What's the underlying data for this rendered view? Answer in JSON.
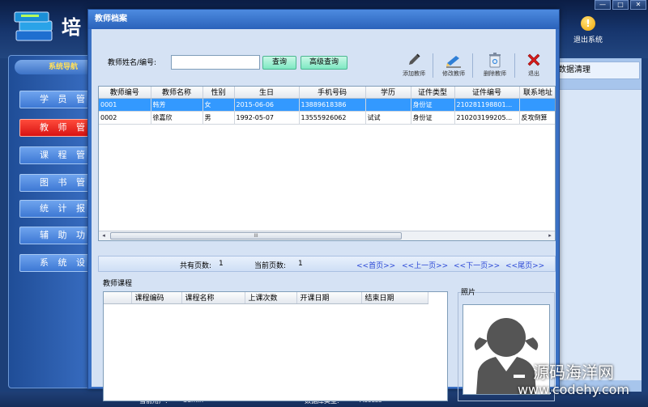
{
  "app": {
    "title": "培",
    "exit_label": "退出系统",
    "window_controls": [
      "—",
      "□",
      "✕"
    ]
  },
  "sidebar": {
    "header": "系统导航",
    "items": [
      {
        "label": "学 员 管 理",
        "active": false
      },
      {
        "label": "教 师 管 理",
        "active": true
      },
      {
        "label": "课 程 管 理",
        "active": false
      },
      {
        "label": "图 书 管 理",
        "active": false
      },
      {
        "label": "统 计 报 表",
        "active": false
      },
      {
        "label": "辅 助 功 能",
        "active": false
      },
      {
        "label": "系 统 设 置",
        "active": false
      }
    ]
  },
  "right_panel": {
    "tab": "数据清理"
  },
  "status_bar": {
    "user_label": "当前用户:",
    "user_value": "admin",
    "db_label": "数据库类型:",
    "db_value": "Access"
  },
  "watermark": {
    "line1": "源码海洋网",
    "line2": "www.codehy.com"
  },
  "dialog": {
    "title": "教师档案",
    "search": {
      "label": "教师姓名/编号:",
      "value": "",
      "query_button": "查询",
      "advanced_button": "高级查询"
    },
    "toolbar": {
      "add": "添加教师",
      "edit": "修改教师",
      "delete": "删除教师",
      "exit": "退出"
    },
    "grid": {
      "columns": [
        "教师编号",
        "教师名称",
        "性别",
        "生日",
        "手机号码",
        "学历",
        "证件类型",
        "证件编号",
        "联系地址"
      ],
      "rows": [
        {
          "id": "0001",
          "name": "韩芳",
          "gender": "女",
          "birthday": "2015-06-06",
          "phone": "13889618386",
          "edu": "",
          "id_type": "身份证",
          "id_no": "210281198801...",
          "address": "",
          "selected": true
        },
        {
          "id": "0002",
          "name": "徐嘉欣",
          "gender": "男",
          "birthday": "1992-05-07",
          "phone": "13555926062",
          "edu": "试试",
          "id_type": "身份证",
          "id_no": "210203199205...",
          "address": "反攻倒算",
          "selected": false
        }
      ],
      "scroll_grip": "III"
    },
    "pager": {
      "total_label": "共有页数:",
      "total_value": "1",
      "current_label": "当前页数:",
      "current_value": "1",
      "first": "<<首页>>",
      "prev": "<<上一页>>",
      "next": "<<下一页>>",
      "last": "<<尾页>>"
    },
    "courses": {
      "label": "教师课程",
      "columns": [
        "课程编码",
        "课程名称",
        "上课次数",
        "开课日期",
        "结束日期"
      ]
    },
    "photo": {
      "label": "照片"
    }
  }
}
